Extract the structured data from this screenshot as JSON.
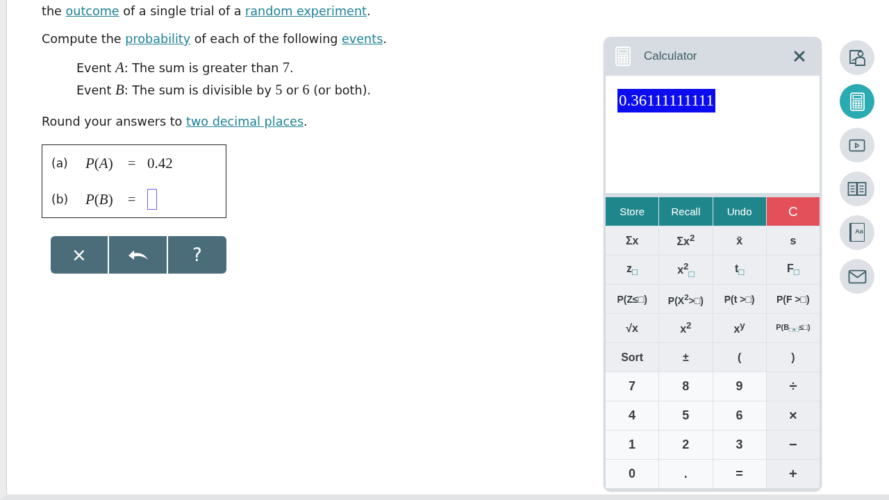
{
  "question": {
    "paragraphs": [
      {
        "kind": "plain",
        "segments": [
          {
            "kind": "text",
            "text": "the "
          },
          {
            "kind": "link",
            "text": "outcome"
          },
          {
            "kind": "text",
            "text": " of a single trial of a "
          },
          {
            "kind": "link",
            "text": "random experiment"
          },
          {
            "kind": "text",
            "text": "."
          }
        ]
      },
      {
        "kind": "plain",
        "segments": [
          {
            "kind": "text",
            "text": "Compute the "
          },
          {
            "kind": "link",
            "text": "probability"
          },
          {
            "kind": "text",
            "text": " of each of the following "
          },
          {
            "kind": "link",
            "text": "events"
          },
          {
            "kind": "text",
            "text": "."
          }
        ]
      },
      {
        "kind": "event",
        "segments": [
          {
            "kind": "text",
            "text": "Event "
          },
          {
            "kind": "variable",
            "text": "A"
          },
          {
            "kind": "text",
            "text": ": The sum is greater than "
          },
          {
            "kind": "number",
            "text": "7"
          },
          {
            "kind": "text",
            "text": "."
          }
        ]
      },
      {
        "kind": "event",
        "segments": [
          {
            "kind": "text",
            "text": "Event "
          },
          {
            "kind": "variable",
            "text": "B"
          },
          {
            "kind": "text",
            "text": ": The sum is divisible by "
          },
          {
            "kind": "number",
            "text": "5"
          },
          {
            "kind": "text",
            "text": " or "
          },
          {
            "kind": "number",
            "text": "6"
          },
          {
            "kind": "text",
            "text": " (or both)."
          }
        ]
      },
      {
        "kind": "plain",
        "segments": [
          {
            "kind": "text",
            "text": "Round your answers to "
          },
          {
            "kind": "link",
            "text": "two decimal places"
          },
          {
            "kind": "text",
            "text": "."
          }
        ]
      }
    ]
  },
  "answers": [
    {
      "label": "(a)",
      "expression": "*P*(*A*)",
      "sign": "=",
      "kind": "value",
      "value": "0.42"
    },
    {
      "label": "(b)",
      "expression": "*P*(*B*)",
      "sign": "=",
      "kind": "input"
    }
  ],
  "action_buttons": [
    {
      "kind": "clear",
      "label": "×"
    },
    {
      "kind": "undo"
    },
    {
      "kind": "help",
      "label": "?"
    }
  ],
  "calculator": {
    "title": "Calculator",
    "display": {
      "value": "0.36111111111",
      "selected": true
    },
    "key_rows": [
      [
        {
          "kind": "action",
          "label": "Store"
        },
        {
          "kind": "action",
          "label": "Recall"
        },
        {
          "kind": "action",
          "label": "Undo"
        },
        {
          "kind": "clear",
          "label": "C"
        }
      ],
      [
        {
          "kind": "function",
          "label": "Σx"
        },
        {
          "kind": "function",
          "label": "Σx$^{2}$"
        },
        {
          "kind": "function",
          "label": "x̄"
        },
        {
          "kind": "function",
          "label": "s"
        }
      ],
      [
        {
          "kind": "function",
          "label": "z$_{□}$"
        },
        {
          "kind": "function",
          "label": "x$^{2}$$_{□}$"
        },
        {
          "kind": "function",
          "label": "t$_{□}$"
        },
        {
          "kind": "function",
          "label": "F$_{□}$"
        }
      ],
      [
        {
          "kind": "function",
          "label": "P(Z≤□)"
        },
        {
          "kind": "function",
          "label": "P(X$^{2}$>□)"
        },
        {
          "kind": "function",
          "label": "P(t >□)"
        },
        {
          "kind": "function",
          "label": "P(F >□)"
        }
      ],
      [
        {
          "kind": "function",
          "label": "√x"
        },
        {
          "kind": "function",
          "label": "x$^{2}$"
        },
        {
          "kind": "function",
          "label": "x$^{y}$"
        },
        {
          "kind": "function",
          "label": "P(B$_{□}$,$_{□}$≤□)"
        }
      ],
      [
        {
          "kind": "function",
          "label": "Sort"
        },
        {
          "kind": "function",
          "label": "±"
        },
        {
          "kind": "function",
          "label": "("
        },
        {
          "kind": "function",
          "label": ")"
        }
      ],
      [
        {
          "kind": "digit",
          "label": "7"
        },
        {
          "kind": "digit",
          "label": "8"
        },
        {
          "kind": "digit",
          "label": "9"
        },
        {
          "kind": "operator",
          "label": "÷"
        }
      ],
      [
        {
          "kind": "digit",
          "label": "4"
        },
        {
          "kind": "digit",
          "label": "5"
        },
        {
          "kind": "digit",
          "label": "6"
        },
        {
          "kind": "operator",
          "label": "×"
        }
      ],
      [
        {
          "kind": "digit",
          "label": "1"
        },
        {
          "kind": "digit",
          "label": "2"
        },
        {
          "kind": "digit",
          "label": "3"
        },
        {
          "kind": "operator",
          "label": "−"
        }
      ],
      [
        {
          "kind": "digit",
          "label": "0"
        },
        {
          "kind": "digit",
          "label": "."
        },
        {
          "kind": "digit",
          "label": "="
        },
        {
          "kind": "operator",
          "label": "+"
        }
      ]
    ]
  },
  "tools": [
    {
      "kind": "tutor",
      "selected": false
    },
    {
      "kind": "calculator",
      "selected": true
    },
    {
      "kind": "video",
      "selected": false
    },
    {
      "kind": "ebook",
      "selected": false
    },
    {
      "kind": "glossary",
      "label": "Aa",
      "selected": false
    },
    {
      "kind": "message",
      "selected": false
    }
  ]
}
